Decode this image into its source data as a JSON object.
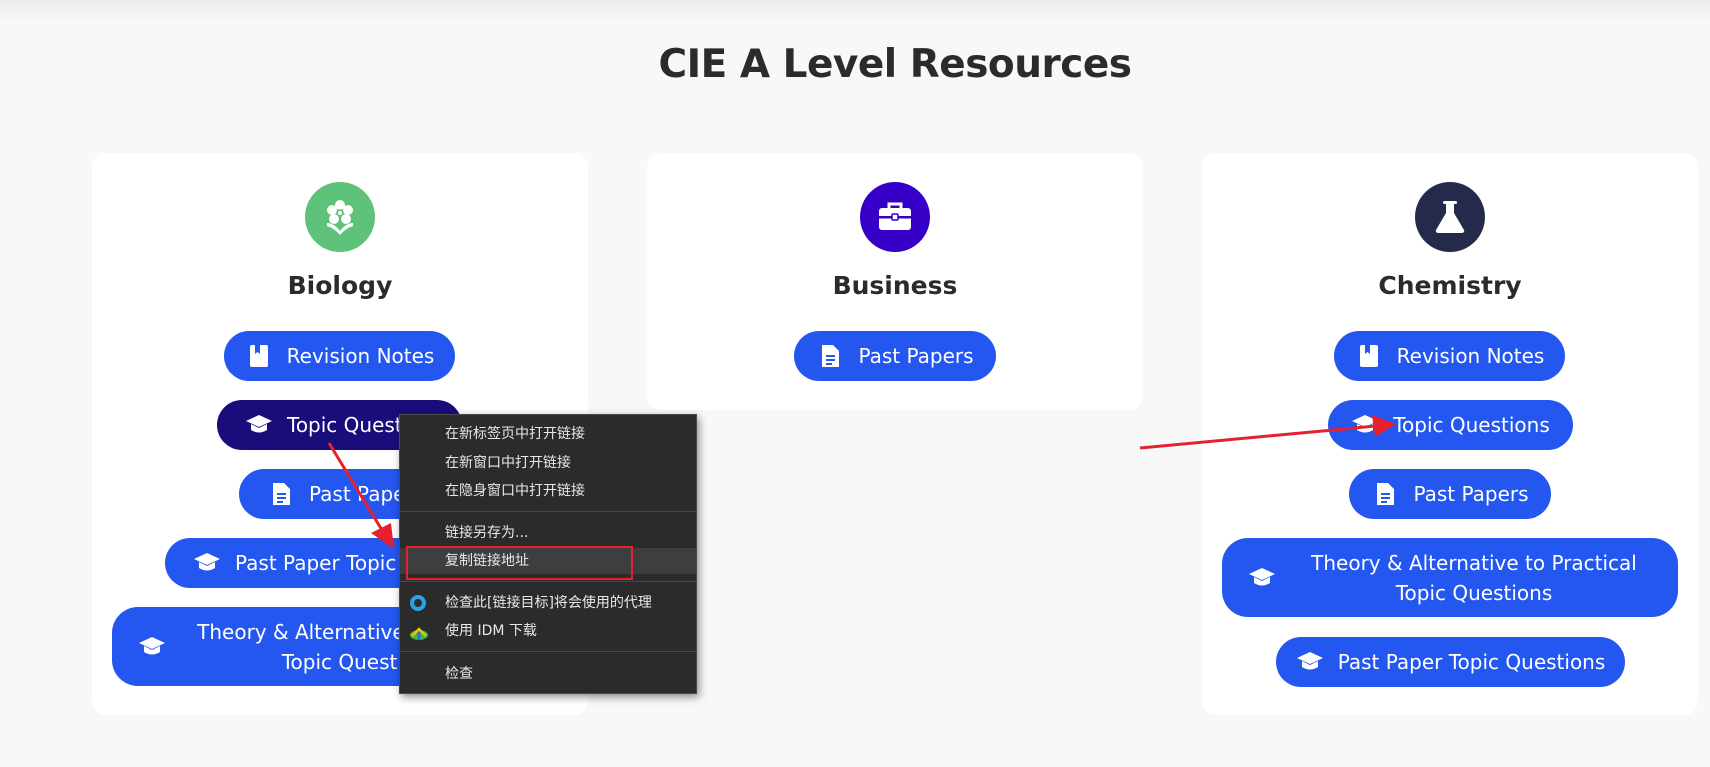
{
  "page": {
    "title": "CIE A Level Resources"
  },
  "cards": {
    "biology": {
      "name": "Biology",
      "icon": "flower-icon",
      "icon_color": "#5ec27a",
      "buttons": [
        {
          "label": "Revision Notes",
          "icon": "book-icon"
        },
        {
          "label": "Topic Questions",
          "icon": "graduation-cap-icon"
        },
        {
          "label": "Past Papers",
          "icon": "document-icon"
        },
        {
          "label": "Past Paper Topic Questions",
          "icon": "graduation-cap-icon"
        },
        {
          "label": "Theory & Alternative to Practical Topic Questions",
          "icon": "graduation-cap-icon"
        }
      ]
    },
    "business": {
      "name": "Business",
      "icon": "briefcase-icon",
      "icon_color": "#3700c8",
      "buttons": [
        {
          "label": "Past Papers",
          "icon": "document-icon"
        }
      ]
    },
    "chemistry": {
      "name": "Chemistry",
      "icon": "flask-icon",
      "icon_color": "#262a4a",
      "buttons": [
        {
          "label": "Revision Notes",
          "icon": "book-icon"
        },
        {
          "label": "Topic Questions",
          "icon": "graduation-cap-icon"
        },
        {
          "label": "Past Papers",
          "icon": "document-icon"
        },
        {
          "label": "Theory & Alternative to Practical Topic Questions",
          "icon": "graduation-cap-icon"
        },
        {
          "label": "Past Paper Topic Questions",
          "icon": "graduation-cap-icon"
        }
      ]
    }
  },
  "context_menu": {
    "items": [
      {
        "label": "在新标签页中打开链接"
      },
      {
        "label": "在新窗口中打开链接"
      },
      {
        "label": "在隐身窗口中打开链接"
      },
      {
        "label": "链接另存为..."
      },
      {
        "label": "复制链接地址",
        "highlighted": true
      },
      {
        "label": "检查此[链接目标]将会使用的代理",
        "icon": "proxy-icon"
      },
      {
        "label": "使用 IDM 下载",
        "icon": "idm-icon"
      },
      {
        "label": "检查"
      }
    ]
  },
  "colors": {
    "button": "#2357f0",
    "button_active": "#180d7a",
    "annotation": "#e8202e",
    "menu_bg": "#2b2b2b"
  }
}
